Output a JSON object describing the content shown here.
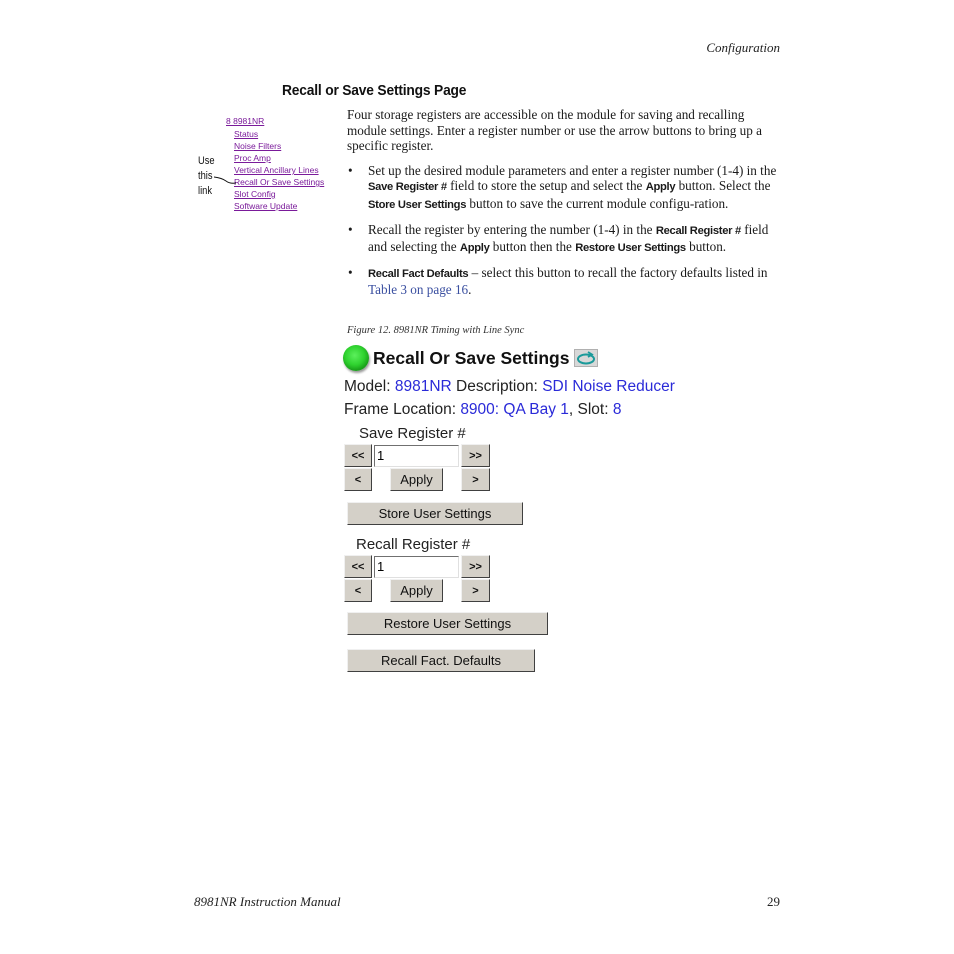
{
  "header": {
    "running_head": "Configuration"
  },
  "section": {
    "title": "Recall or Save Settings Page"
  },
  "nav_thumbnail": {
    "root": "8 8981NR",
    "items": [
      "Status",
      "Noise Filters",
      "Proc Amp",
      "Vertical Ancillary Lines",
      "Recall Or Save Settings",
      "Slot Config",
      "Software Update"
    ],
    "callout": [
      "Use",
      "this",
      "link"
    ]
  },
  "body": {
    "intro": "Four storage registers are accessible on the module for saving and recalling module settings. Enter a register number or use the arrow buttons to bring up a specific register.",
    "bullet1": {
      "t1": "Set up the desired module parameters and enter a register number (1-4) in the ",
      "term1": "Save Register #",
      "t2": " field to store the setup and select the ",
      "term2": "Apply",
      "t3": " button. Select the ",
      "term3": "Store User Settings",
      "t4": " button to save the current module configu-ration."
    },
    "bullet2": {
      "t1": "Recall the register by entering the number (1-4) in the ",
      "term1": "Recall Register #",
      "t2": " field and selecting the ",
      "term2": "Apply",
      "t3": " button then the ",
      "term3": "Restore User Settings",
      "t4": " button."
    },
    "bullet3": {
      "term1": "Recall Fact Defaults",
      "t1": " – select this button to recall the factory defaults listed in ",
      "link": "Table 3 on page 16",
      "t2": "."
    }
  },
  "figure": {
    "caption": "Figure 12.  8981NR Timing with Line Sync"
  },
  "panel": {
    "title": "Recall Or Save Settings",
    "model_label": "Model:",
    "model_value": "8981NR",
    "description_label": "Description:",
    "description_value": "SDI Noise Reducer",
    "frame_location_label": "Frame Location:",
    "frame_location_value": "8900: QA Bay 1",
    "slot_label": ", Slot:",
    "slot_value": "8",
    "colors": {
      "value_text": "#2a2ad8",
      "led": "#2fd22f"
    },
    "save_register": {
      "label": "Save Register #",
      "value": "1",
      "first_label": "<<",
      "last_label": ">>",
      "prev_label": "<",
      "next_label": ">",
      "apply_label": "Apply",
      "store_label": "Store User Settings"
    },
    "recall_register": {
      "label": "Recall Register #",
      "value": "1",
      "first_label": "<<",
      "last_label": ">>",
      "prev_label": "<",
      "next_label": ">",
      "apply_label": "Apply",
      "restore_label": "Restore User Settings",
      "defaults_label": "Recall Fact. Defaults"
    }
  },
  "footer": {
    "manual_title": "8981NR Instruction Manual",
    "page_number": "29"
  }
}
